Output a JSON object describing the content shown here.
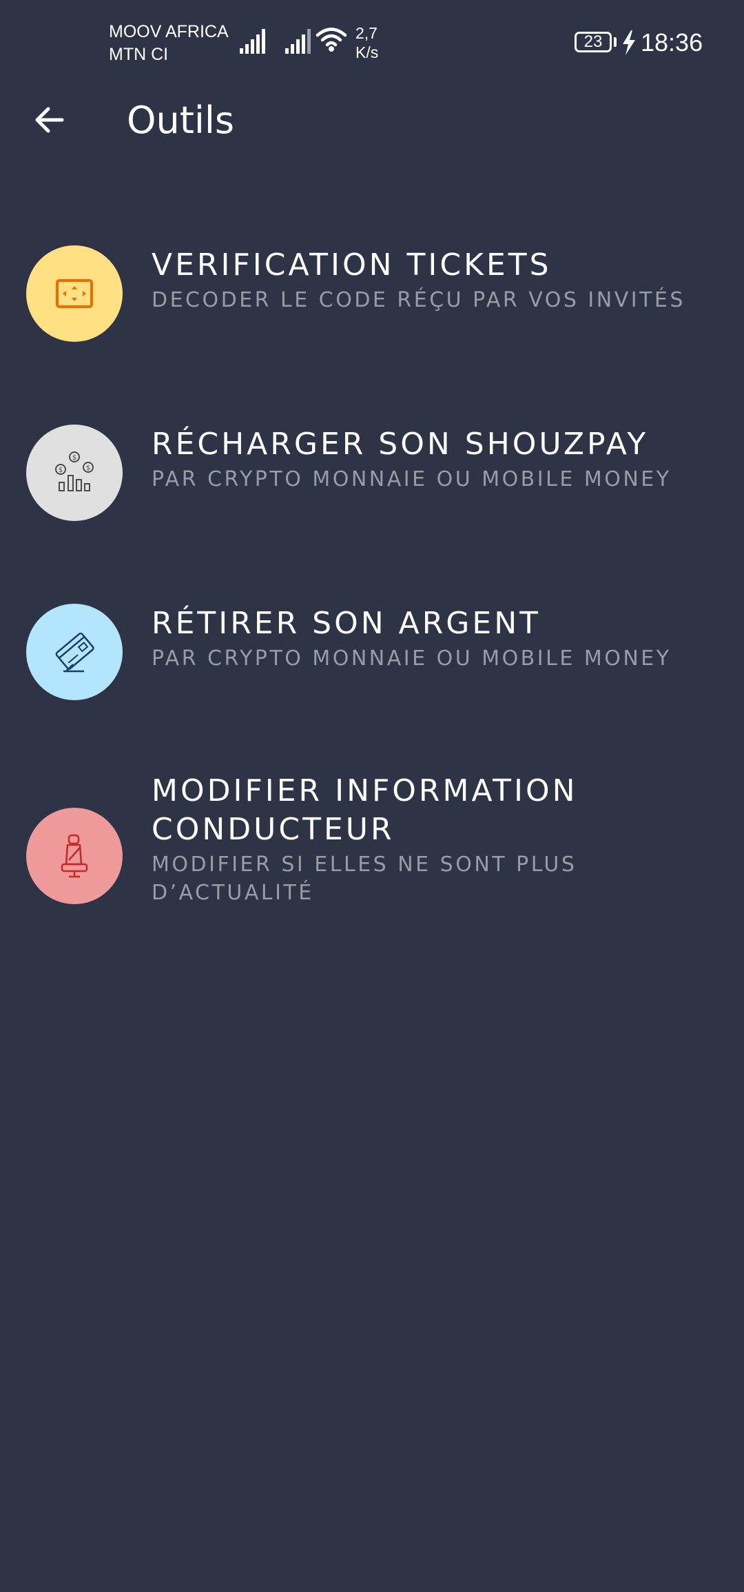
{
  "status_bar": {
    "carrier_1": "MOOV AFRICA",
    "carrier_2": "MTN CI",
    "speed_value": "2,7",
    "speed_unit": "K/s",
    "battery_level": "23",
    "time": "18:36"
  },
  "header": {
    "title": "Outils"
  },
  "menu": {
    "items": [
      {
        "title": "VERIFICATION TICKETS",
        "subtitle": "DECODER LE CODE RÉÇU PAR VOS INVITÉS",
        "icon": "ticket-scan-icon",
        "icon_bg": "#ffe082",
        "icon_color": "#ef6c00"
      },
      {
        "title": "RÉCHARGER SON SHOUZPAY",
        "subtitle": "PAR CRYPTO MONNAIE OU MOBILE MONEY",
        "icon": "coins-chart-icon",
        "icon_bg": "#e0e0e0",
        "icon_color": "#4a4a4a"
      },
      {
        "title": "RÉTIRER SON ARGENT",
        "subtitle": "PAR CRYPTO MONNAIE OU MOBILE MONEY",
        "icon": "credit-card-icon",
        "icon_bg": "#b3e5fc",
        "icon_color": "#1a3a6b"
      },
      {
        "title": "MODIFIER INFORMATION CONDUCTEUR",
        "subtitle": "MODIFIER SI ELLES NE SONT PLUS D’ACTUALITÉ",
        "icon": "car-seat-icon",
        "icon_bg": "#ef9a9a",
        "icon_color": "#c62828"
      }
    ]
  }
}
